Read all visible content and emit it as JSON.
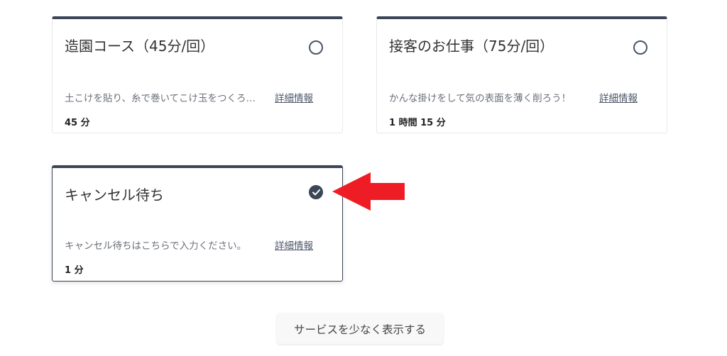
{
  "cards": [
    {
      "title": "造園コース（45分/回）",
      "description": "土こけを貼り、糸で巻いてこけ玉をつくろ…",
      "detail_link": "詳細情報",
      "duration": "45 分",
      "selected": false
    },
    {
      "title": "接客のお仕事（75分/回）",
      "description": "かんな掛けをして気の表面を薄く削ろう！",
      "detail_link": "詳細情報",
      "duration": "1 時間 15 分",
      "selected": false
    },
    {
      "title": "キャンセル待ち",
      "description": "キャンセル待ちはこちらで入力ください。",
      "detail_link": "詳細情報",
      "duration": "1 分",
      "selected": true
    }
  ],
  "show_less_button": "サービスを少なく表示する",
  "annotation": {
    "icon": "red-arrow-icon",
    "color": "#ee1c25"
  },
  "colors": {
    "accent": "#3c4658"
  }
}
